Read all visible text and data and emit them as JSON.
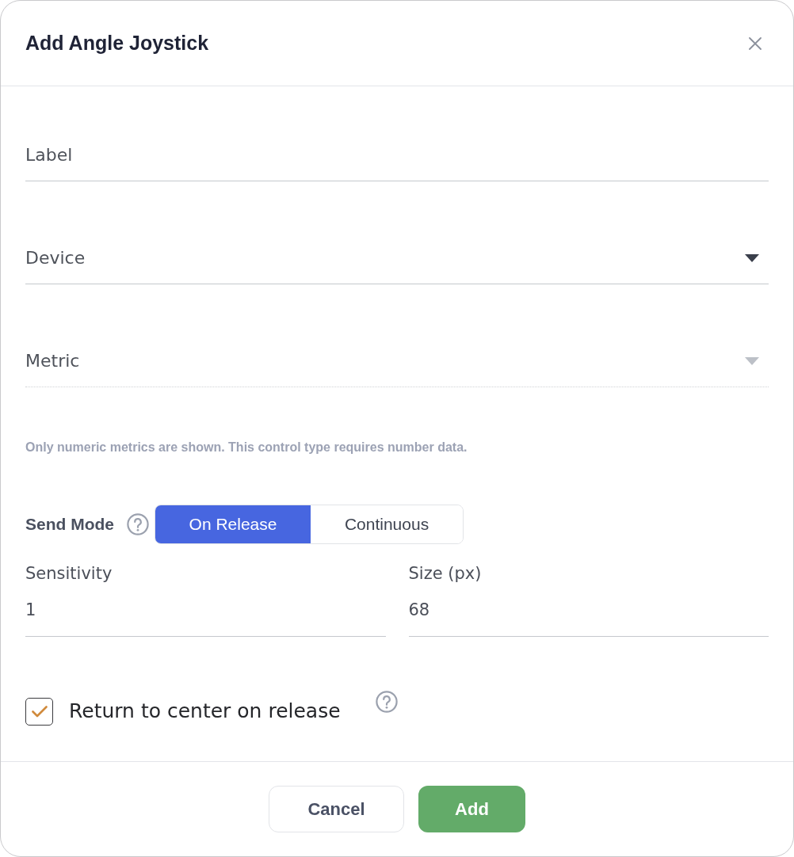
{
  "dialog": {
    "title": "Add Angle Joystick"
  },
  "fields": [
    {
      "kind": "text",
      "placeholder": "Label",
      "disabled": false
    },
    {
      "kind": "select",
      "placeholder": "Device",
      "disabled": false
    },
    {
      "kind": "select",
      "placeholder": "Metric",
      "disabled": true
    }
  ],
  "hint": "Only numeric metrics are shown. This control type requires number data.",
  "send_mode": {
    "label": "Send Mode",
    "options": [
      {
        "label": "On Release",
        "selected": true
      },
      {
        "label": "Continuous",
        "selected": false
      }
    ]
  },
  "number_fields": [
    {
      "label": "Sensitivity",
      "value": "1"
    },
    {
      "label": "Size (px)",
      "value": "68"
    }
  ],
  "checkbox": {
    "label": "Return to center on release",
    "checked": true
  },
  "buttons": [
    {
      "label": "Cancel",
      "kind": "secondary"
    },
    {
      "label": "Add",
      "kind": "primary"
    }
  ]
}
